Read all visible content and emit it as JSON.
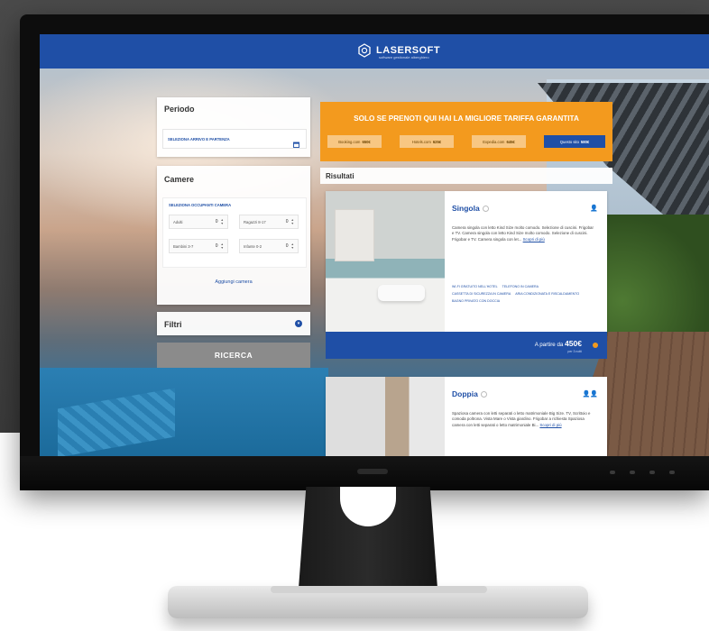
{
  "brand": {
    "name": "LASERSOFT",
    "tagline": "software gestionale alberghiero"
  },
  "sidebar": {
    "periodo": {
      "title": "Periodo",
      "date_placeholder": "SELEZIONA ARRIVO E PARTENZA"
    },
    "camere": {
      "title": "Camere",
      "occupants_title": "SELEZIONA OCCUPANTI CAMERA",
      "fields": [
        {
          "label": "Adulti",
          "value": "0"
        },
        {
          "label": "Ragazzi 8-17",
          "value": "0"
        },
        {
          "label": "Bambini 3-7",
          "value": "0"
        },
        {
          "label": "Infante 0-2",
          "value": "0"
        }
      ],
      "add_room": "Aggiungi camera"
    },
    "filtri": {
      "title": "Filtri"
    },
    "search_button": "RICERCA"
  },
  "banner": {
    "title": "SOLO SE PRENOTI QUI HAI LA MIGLIORE TARIFFA GARANTITA",
    "prices": [
      {
        "site": "Booking.com",
        "price": "650€"
      },
      {
        "site": "Hotels.com",
        "price": "625€"
      },
      {
        "site": "Expedia.com",
        "price": "645€"
      },
      {
        "site": "Questo sito",
        "price": "580€"
      }
    ]
  },
  "results": {
    "title": "Risultati",
    "rooms": [
      {
        "name": "Singola",
        "description": "Camera singola con letto Kind Size molto comodo. Selezione di cuscini. Frigobar e TV. Camera singola con letto Kind Size molto comodo. Selezione di cuscini. Frigobar e TV. Camera singola con let...",
        "more": "Scopri di più",
        "amenities": [
          "WI-FI GRATUITO NELL'HOTEL",
          "TELEFONO IN CAMERA",
          "CASSETTA DI SICUREZZA IN CAMERA",
          "ARIA CONDIZIONATA E RISCALDAMENTO",
          "BAGNO PRIVATO CON DOCCIA"
        ],
        "price_label": "A partire da",
        "price": "450€",
        "price_note": "per 3 notti"
      },
      {
        "name": "Doppia",
        "description": "Spaziosa camera con letti separati o letto matrimoniale Big Size. TV, Scrittoio e comoda poltrona. Vista Mare o Vista giardino. Frigobar a richiesta Spaziosa camera con letti separati o letto matrimoniale Bi...",
        "more": "Scopri di più"
      }
    ]
  }
}
